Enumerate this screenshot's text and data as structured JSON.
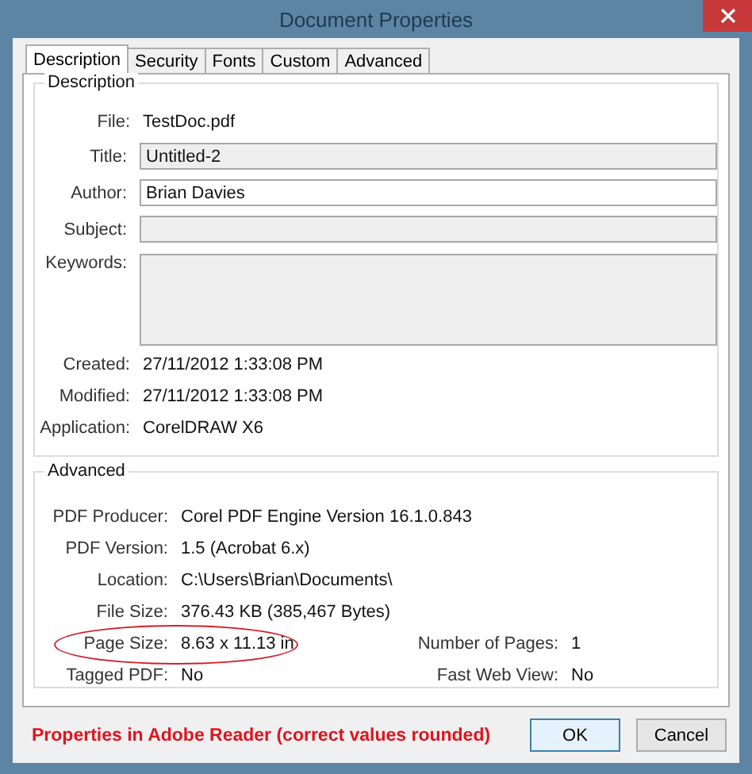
{
  "window": {
    "title": "Document Properties"
  },
  "tabs": [
    {
      "label": "Description",
      "selected": true
    },
    {
      "label": "Security",
      "selected": false
    },
    {
      "label": "Fonts",
      "selected": false
    },
    {
      "label": "Custom",
      "selected": false
    },
    {
      "label": "Advanced",
      "selected": false
    }
  ],
  "description": {
    "heading": "Description",
    "fields": [
      {
        "kind": "text",
        "label": "File:",
        "value": "TestDoc.pdf"
      },
      {
        "kind": "input",
        "label": "Title:",
        "value": "Untitled-2",
        "disabled": true
      },
      {
        "kind": "input",
        "label": "Author:",
        "value": "Brian Davies",
        "disabled": false
      },
      {
        "kind": "input",
        "label": "Subject:",
        "disabled": true
      },
      {
        "kind": "textarea",
        "label": "Keywords:",
        "disabled": true
      },
      {
        "kind": "text",
        "label": "Created:",
        "value": "27/11/2012 1:33:08 PM"
      },
      {
        "kind": "text",
        "label": "Modified:",
        "value": "27/11/2012 1:33:08 PM"
      },
      {
        "kind": "text",
        "label": "Application:",
        "value": "CorelDRAW X6"
      }
    ]
  },
  "advanced": {
    "heading": "Advanced",
    "rows": [
      [
        {
          "label": "PDF Producer:",
          "value": "Corel PDF Engine Version 16.1.0.843"
        }
      ],
      [
        {
          "label": "PDF Version:",
          "value": "1.5 (Acrobat 6.x)"
        }
      ],
      [
        {
          "label": "Location:",
          "value": "C:\\Users\\Brian\\Documents\\"
        }
      ],
      [
        {
          "label": "File Size:",
          "value": "376.43 KB (385,467 Bytes)"
        }
      ],
      [
        {
          "label": "Page Size:",
          "value": "8.63 x 11.13 in",
          "circled": true
        },
        {
          "label": "Number of Pages:",
          "value": "1"
        }
      ],
      [
        {
          "label": "Tagged PDF:",
          "value": "No"
        },
        {
          "label": "Fast Web View:",
          "value": "No"
        }
      ]
    ]
  },
  "note": "Properties in Adobe Reader (correct values rounded)",
  "buttons": [
    "OK",
    "Cancel"
  ]
}
